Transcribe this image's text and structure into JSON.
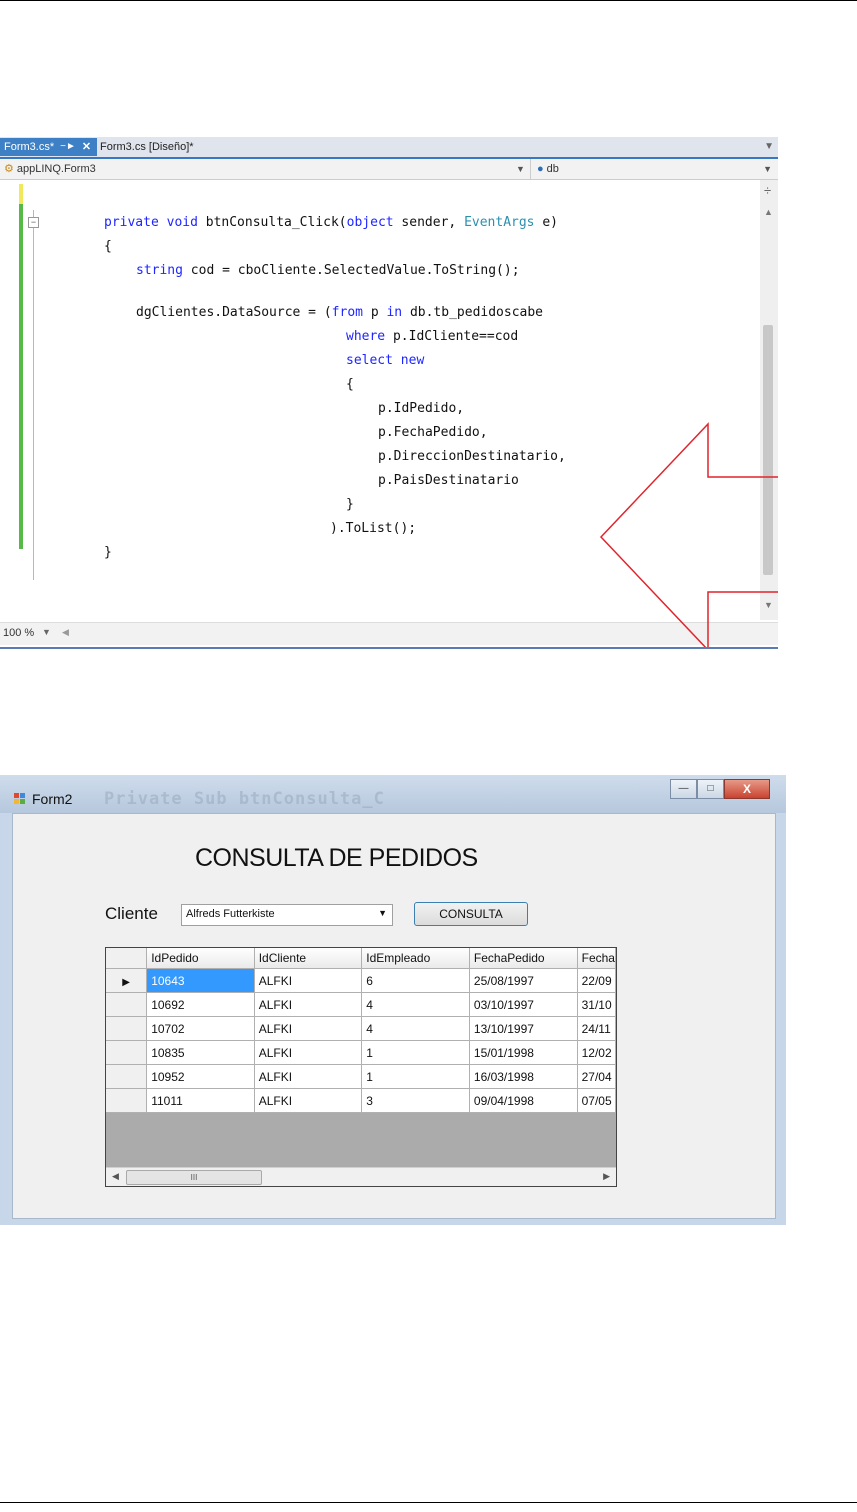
{
  "editor": {
    "tabs": [
      {
        "label": "Form3.cs*",
        "active": true
      },
      {
        "label": "Form3.cs [Diseño]*",
        "active": false
      }
    ],
    "nav_left": "appLINQ.Form3",
    "nav_right": "db",
    "zoom": "100 %",
    "code_lines": [
      "private void btnConsulta_Click(object sender, EventArgs e)",
      "{",
      "string cod = cboCliente.SelectedValue.ToString();",
      "dgClientes.DataSource = (from p in db.tb_pedidoscabe",
      "where p.IdCliente==cod",
      "select new",
      "{",
      "p.IdPedido,",
      "p.FechaPedido,",
      "p.DireccionDestinatario,",
      "p.PaisDestinatario",
      "}",
      ").ToList();",
      "}"
    ],
    "colors": {
      "keyword": "#1e26ff",
      "type": "#2b91af",
      "arrow": "#e0242c"
    }
  },
  "form": {
    "window_title": "Form2",
    "background_ghost_text": "Private Sub btnConsulta_C",
    "heading": "CONSULTA DE PEDIDOS",
    "cliente_label": "Cliente",
    "cliente_selected": "Alfreds Futterkiste",
    "button_label": "CONSULTA",
    "grid": {
      "columns": [
        "IdPedido",
        "IdCliente",
        "IdEmpleado",
        "FechaPedido",
        "Fecha"
      ],
      "rows": [
        [
          "10643",
          "ALFKI",
          "6",
          "25/08/1997",
          "22/09"
        ],
        [
          "10692",
          "ALFKI",
          "4",
          "03/10/1997",
          "31/10"
        ],
        [
          "10702",
          "ALFKI",
          "4",
          "13/10/1997",
          "24/11"
        ],
        [
          "10835",
          "ALFKI",
          "1",
          "15/01/1998",
          "12/02"
        ],
        [
          "10952",
          "ALFKI",
          "1",
          "16/03/1998",
          "27/04"
        ],
        [
          "11011",
          "ALFKI",
          "3",
          "09/04/1998",
          "07/05"
        ]
      ],
      "scroll_thumb_label": "III"
    }
  }
}
